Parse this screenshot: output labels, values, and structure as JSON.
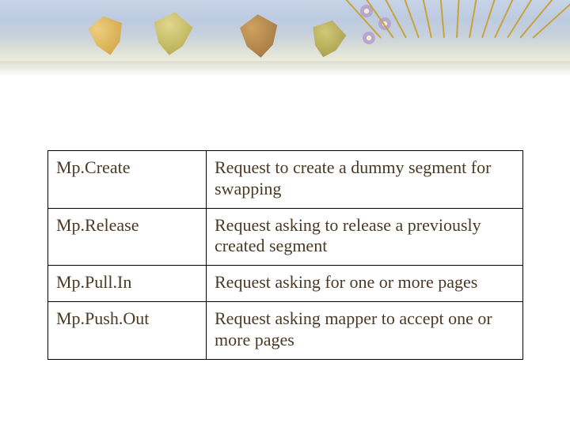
{
  "table": {
    "rows": [
      {
        "name": "Mp.Create",
        "desc": "Request to create a dummy segment for swapping"
      },
      {
        "name": "Mp.Release",
        "desc": "Request asking to release a previously created segment"
      },
      {
        "name": "Mp.Pull.In",
        "desc": "Request asking for one or more pages"
      },
      {
        "name": "Mp.Push.Out",
        "desc": "Request asking mapper to accept one or more pages"
      }
    ]
  }
}
